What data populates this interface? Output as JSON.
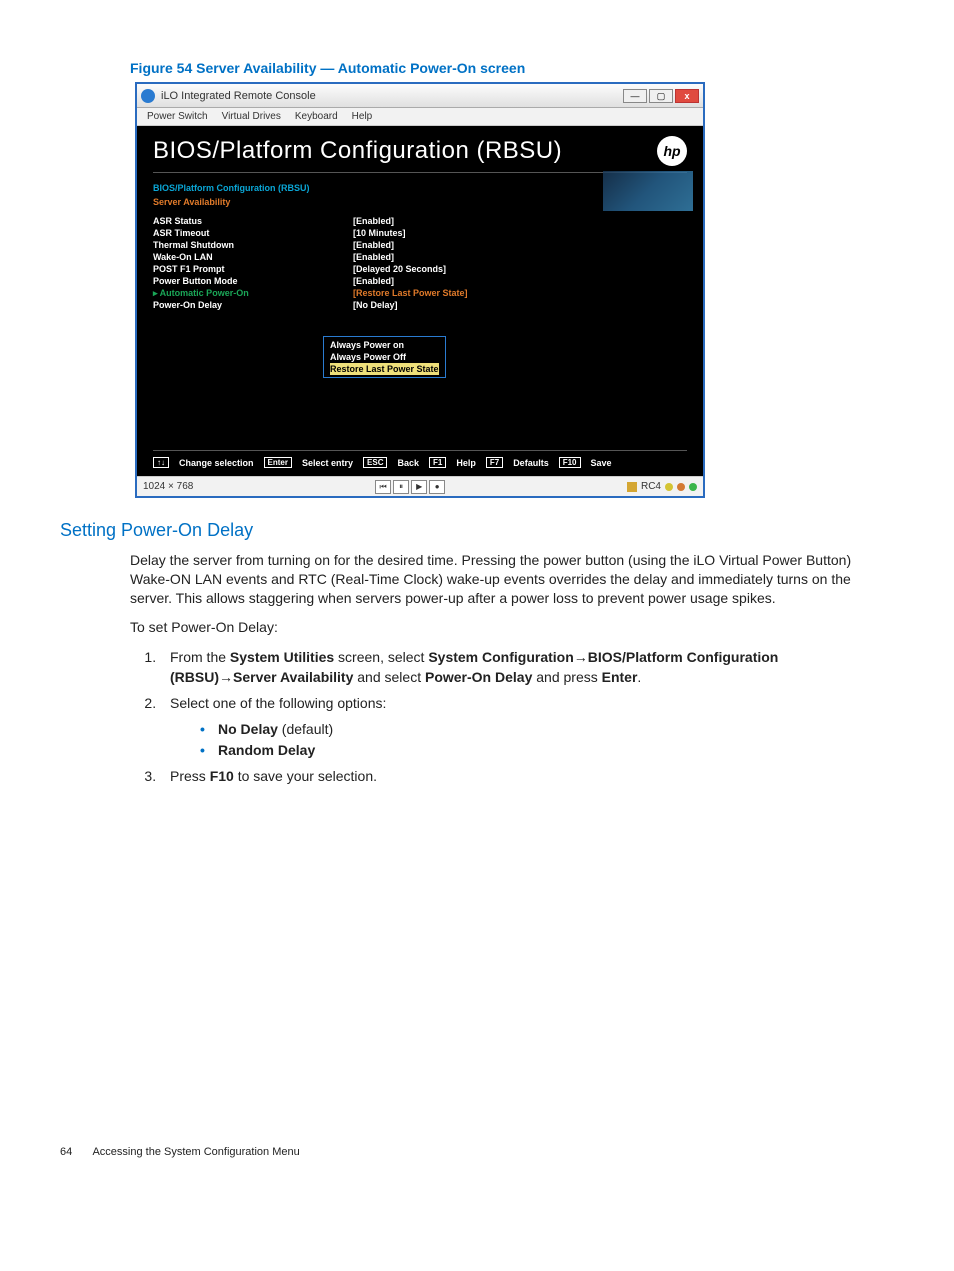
{
  "figure": {
    "caption": "Figure 54 Server Availability — Automatic Power-On screen"
  },
  "window": {
    "title": "iLO Integrated Remote Console",
    "buttons": {
      "min": "—",
      "max": "▢",
      "close": "x"
    },
    "menu": [
      "Power Switch",
      "Virtual Drives",
      "Keyboard",
      "Help"
    ]
  },
  "bios": {
    "title": "BIOS/Platform Configuration (RBSU)",
    "logo": "hp",
    "crumb1": "BIOS/Platform Configuration (RBSU)",
    "crumb2": "Server Availability",
    "rows": [
      {
        "label": "ASR Status",
        "value": "[Enabled]"
      },
      {
        "label": "ASR Timeout",
        "value": "[10 Minutes]"
      },
      {
        "label": "Thermal Shutdown",
        "value": "[Enabled]"
      },
      {
        "label": "Wake-On LAN",
        "value": "[Enabled]"
      },
      {
        "label": "POST F1 Prompt",
        "value": "[Delayed 20 Seconds]"
      },
      {
        "label": "Power Button Mode",
        "value": "[Enabled]"
      },
      {
        "label": "▸ Automatic Power-On",
        "value": "[Restore Last Power State]",
        "selected": true
      },
      {
        "label": "Power-On Delay",
        "value": "[No Delay]"
      }
    ],
    "popup": [
      "Always Power on",
      "Always Power Off",
      "Restore Last Power State"
    ],
    "popup_selected_index": 2,
    "keys": [
      {
        "k": "↑↓",
        "t": "Change selection"
      },
      {
        "k": "Enter",
        "t": "Select entry"
      },
      {
        "k": "ESC",
        "t": "Back"
      },
      {
        "k": "F1",
        "t": "Help"
      },
      {
        "k": "F7",
        "t": "Defaults"
      },
      {
        "k": "F10",
        "t": "Save"
      }
    ]
  },
  "status": {
    "resolution": "1024 × 768",
    "rc": "RC4"
  },
  "section": {
    "heading": "Setting Power-On Delay",
    "para1": "Delay the server from turning on for the desired time. Pressing the power button (using the iLO Virtual Power Button) Wake-ON LAN events and RTC (Real-Time Clock) wake-up events overrides the delay and immediately turns on the server. This allows staggering when servers power-up after a power loss to prevent power usage spikes.",
    "para2": "To set Power-On Delay:",
    "step1_a": "From the ",
    "step1_b": "System Utilities",
    "step1_c": " screen, select ",
    "step1_d": "System Configuration",
    "step1_e": "BIOS/Platform Configuration (RBSU)",
    "step1_f": "Server Availability",
    "step1_g": " and select ",
    "step1_h": "Power-On Delay",
    "step1_i": " and press ",
    "step1_j": "Enter",
    "step2": "Select one of the following options:",
    "opt1a": "No Delay",
    "opt1b": " (default)",
    "opt2": "Random Delay",
    "step3a": "Press ",
    "step3b": "F10",
    "step3c": " to save your selection."
  },
  "footer": {
    "page": "64",
    "title": "Accessing the System Configuration Menu"
  }
}
